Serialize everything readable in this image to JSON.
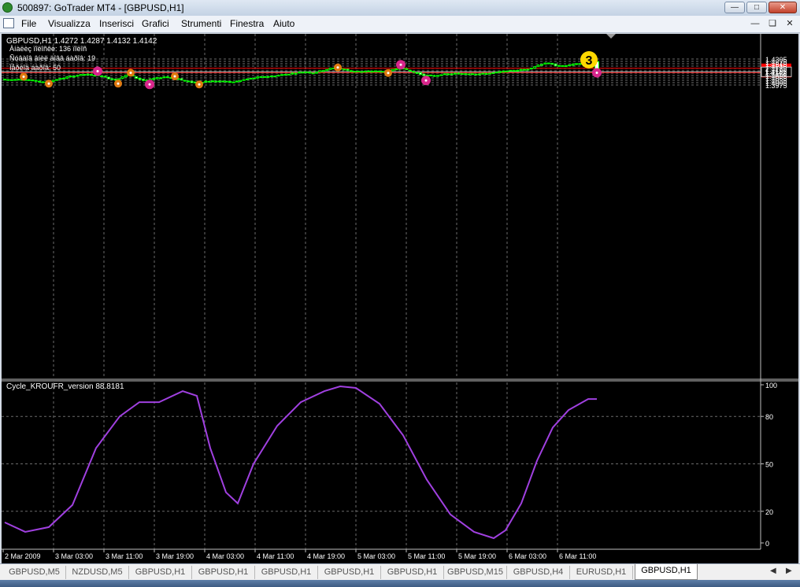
{
  "window": {
    "title": "500897: GoTrader MT4 - [GBPUSD,H1]"
  },
  "menu": [
    "File",
    "Visualizza",
    "Inserisci",
    "Grafici",
    "Strumenti",
    "Finestra",
    "Aiuto"
  ],
  "chart": {
    "header": "GBPUSD,H1  1.4272 1.4287 1.4132 1.4142",
    "info_lines": [
      "Àíàëèç ïîëîñêè: 136 ïîëîñ",
      "Ñóâàîâ âíèë äîââ áàðîâ: 19",
      "Ïåðèîä áàðîâ: 50"
    ],
    "price_ticks": [
      "1.4305",
      "1.4275",
      "1.4245",
      "1.4215",
      "1.4185",
      "1.4155",
      "1.4125",
      "1.4095",
      "1.4065",
      "1.4035",
      "1.4005",
      "1.3975"
    ],
    "hlines": [
      {
        "price": 1.4187,
        "label": "1.4187",
        "color": "#ff0000"
      },
      {
        "price": 1.4132,
        "label": "1.4132",
        "color": "#ff0000"
      },
      {
        "price": 1.4142,
        "label": "1.4142",
        "color": "#c0c0c0"
      }
    ],
    "marker_label": "3",
    "time_ticks": [
      "2 Mar 2009",
      "3 Mar 03:00",
      "3 Mar 11:00",
      "3 Mar 19:00",
      "4 Mar 03:00",
      "4 Mar 11:00",
      "4 Mar 19:00",
      "5 Mar 03:00",
      "5 Mar 11:00",
      "5 Mar 19:00",
      "6 Mar 03:00",
      "6 Mar 11:00"
    ],
    "colors": {
      "bull": "#ffffff",
      "bear": "#00ff00",
      "grid": "#6b6b6b",
      "indicator": "#a040e0",
      "orange": "#e07a10",
      "magenta": "#d8268c"
    }
  },
  "indicator": {
    "label": "Cycle_KROUFR_version 88.8181",
    "ticks": [
      "100",
      "80",
      "50",
      "20",
      "0"
    ]
  },
  "tabs": [
    "GBPUSD,M5",
    "NZDUSD,M5",
    "GBPUSD,H1",
    "GBPUSD,H1",
    "GBPUSD,H1",
    "GBPUSD,H1",
    "GBPUSD,H1",
    "GBPUSD,M15",
    "GBPUSD,H4",
    "EURUSD,H1",
    "GBPUSD,H1"
  ],
  "active_tab": 10
}
